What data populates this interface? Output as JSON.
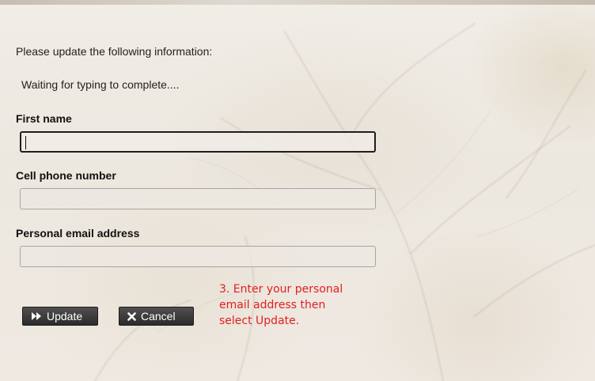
{
  "form": {
    "intro_text": "Please update the following information:",
    "status_text": "Waiting for typing to complete....",
    "fields": [
      {
        "label": "First name",
        "value": "",
        "placeholder": ""
      },
      {
        "label": "Cell phone number",
        "value": "",
        "placeholder": ""
      },
      {
        "label": "Personal email address",
        "value": "",
        "placeholder": ""
      }
    ],
    "buttons": {
      "update_label": "Update",
      "cancel_label": "Cancel"
    }
  },
  "annotation": {
    "lines": [
      "3. Enter your personal",
      "email address then",
      "select Update."
    ],
    "color": "#e02020"
  },
  "icons": {
    "update": "fast-forward-icon",
    "cancel": "x-icon"
  },
  "colors": {
    "button_bg": "#333333",
    "button_text": "#ffffff",
    "focus_border": "#1e1e1e"
  }
}
